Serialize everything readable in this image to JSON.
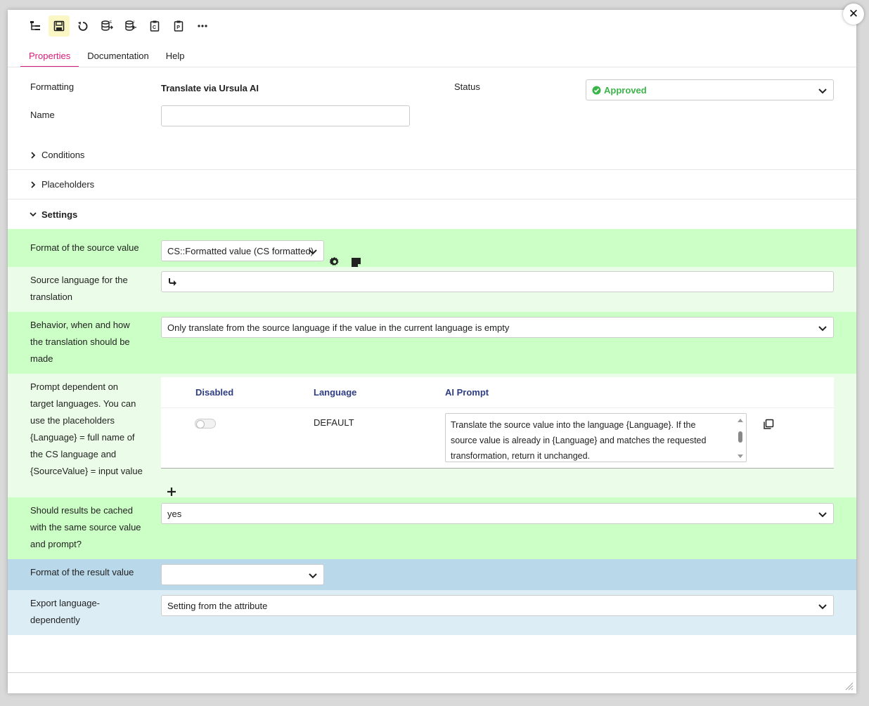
{
  "toolbar": {
    "buttons": [
      "tree-icon",
      "save-icon",
      "reload-icon",
      "db-export-icon",
      "db-import-icon",
      "clipboard-copy-icon",
      "clipboard-paste-icon",
      "more-icon"
    ]
  },
  "tabs": [
    {
      "label": "Properties",
      "active": true
    },
    {
      "label": "Documentation",
      "active": false
    },
    {
      "label": "Help",
      "active": false
    }
  ],
  "header": {
    "formatting_label": "Formatting",
    "formatting_value": "Translate via Ursula AI",
    "status_label": "Status",
    "status_value": "Approved",
    "status_color": "#3bb54a",
    "name_label": "Name",
    "name_value": ""
  },
  "sections": {
    "conditions": "Conditions",
    "placeholders": "Placeholders",
    "settings": "Settings"
  },
  "settings": {
    "source_format_label": "Format of the source value",
    "source_format_value": "CS::Formatted value (CS formatted)",
    "source_lang_label_1": "Source language for the",
    "source_lang_label_2": "translation",
    "source_lang_value": "",
    "behavior_label_1": "Behavior, when and how",
    "behavior_label_2": "the translation should be",
    "behavior_label_3": "made",
    "behavior_value": "Only translate from the source language if the value in the current language is empty",
    "prompt_label_lines": [
      "Prompt dependent on",
      "target languages. You can",
      "use the placeholders",
      "{Language} = full name of",
      "the CS language and",
      "{SourceValue} = input value"
    ],
    "prompt_table": {
      "headers": {
        "disabled": "Disabled",
        "language": "Language",
        "prompt": "AI Prompt"
      },
      "rows": [
        {
          "disabled": false,
          "language": "DEFAULT",
          "prompt_lines": [
            "Translate the source value into the language {Language}. If the",
            "source value is already in {Language} and matches the requested",
            "transformation, return it unchanged."
          ]
        }
      ]
    },
    "cache_label_1": "Should results be cached",
    "cache_label_2": "with the same source value",
    "cache_label_3": "and prompt?",
    "cache_value": "yes",
    "result_format_label": "Format of the result value",
    "result_format_value": "",
    "export_label_1": "Export language-",
    "export_label_2": "dependently",
    "export_value": "Setting from the attribute"
  }
}
